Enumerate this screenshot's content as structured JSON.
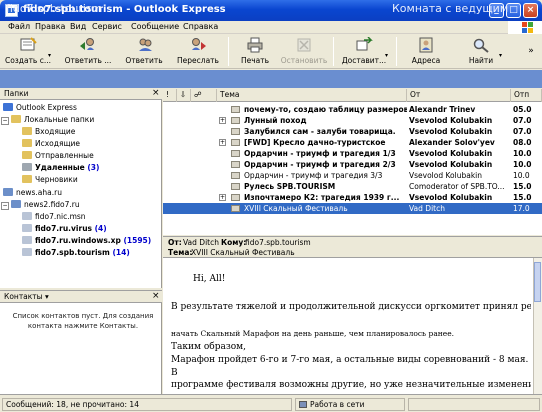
{
  "window": {
    "title": "fido7.spb.tourism - Outlook Express",
    "buttons": {
      "minimize": "_",
      "maximize": "□",
      "close": "×"
    }
  },
  "menu": [
    "Файл",
    "Правка",
    "Вид",
    "Сервис",
    "Сообщение",
    "Справка"
  ],
  "toolbar": {
    "create": "Создать с...",
    "reply": "Ответить ...",
    "reply_all": "Ответить",
    "forward": "Переслать",
    "print": "Печать",
    "delete": "Остановить",
    "send_receive": "Доставит...",
    "addresses": "Адреса",
    "find": "Найти"
  },
  "banner": {
    "title": "fido7.spb.tourism",
    "right": "Комната с ведущим"
  },
  "folders": {
    "header": "Папки",
    "items": [
      {
        "label": "Outlook Express",
        "count": ""
      },
      {
        "label": "Локальные папки",
        "count": ""
      },
      {
        "label": "Входящие",
        "count": ""
      },
      {
        "label": "Исходящие",
        "count": ""
      },
      {
        "label": "Отправленные",
        "count": ""
      },
      {
        "label": "Удаленные",
        "count": "(3)"
      },
      {
        "label": "Черновики",
        "count": ""
      },
      {
        "label": "news.aha.ru",
        "count": ""
      },
      {
        "label": "news2.fido7.ru",
        "count": ""
      },
      {
        "label": "fido7.nic.msn",
        "count": ""
      },
      {
        "label": "fido7.ru.virus",
        "count": "(4)"
      },
      {
        "label": "fido7.ru.windows.xp",
        "count": "(1595)"
      },
      {
        "label": "fido7.spb.tourism",
        "count": "(14)"
      }
    ]
  },
  "contacts": {
    "header": "Контакты ▾",
    "empty_text": "Список контактов пуст. Для создания контакта нажмите Контакты."
  },
  "columns": {
    "subject": "Тема",
    "from": "От",
    "sent": "Отп"
  },
  "messages": [
    {
      "subject": "почему-то, создаю таблицу размеров б...",
      "from": "Alexandr Trinev",
      "date": "05.0"
    },
    {
      "subject": "Лунный поход",
      "from": "Vsevolod Kolubakin",
      "date": "07.0"
    },
    {
      "subject": "Залубился сам - залуби товарища.",
      "from": "Vsevolod Kolubakin",
      "date": "07.0"
    },
    {
      "subject": "[FWD] Кресло дачно-туристское",
      "from": "Alexander Solov'yev",
      "date": "08.0"
    },
    {
      "subject": "Ордарчин - триумф и трагедия 1/3",
      "from": "Vsevolod Kolubakin",
      "date": "10.0"
    },
    {
      "subject": "Ордарчин - триумф и трагедия 2/3",
      "from": "Vsevolod Kolubakin",
      "date": "10.0"
    },
    {
      "subject": "Ордарчин - триумф и трагедия 3/3",
      "from": "Vsevolod Kolubakin",
      "date": "10.0"
    },
    {
      "subject": "Рулесь SPB.TOURISM",
      "from": "Comoderator of SPB.TO...",
      "date": "15.0"
    },
    {
      "subject": "Изпочтамеро К2: трагедия 1939 г...",
      "from": "Vsevolod Kolubakin",
      "date": "15.0"
    },
    {
      "subject": "XVIII Скальный Фестиваль",
      "from": "Vad Ditch",
      "date": "17.0"
    }
  ],
  "preview": {
    "from_label": "От:",
    "from": "Vad Ditch",
    "to_label": "Кому:",
    "to": "fido7.spb.tourism",
    "subject_label": "Тема:",
    "subject": "XVIII Скальный Фестиваль",
    "body": [
      "Hi, All!",
      "В результате тяжелой и продолжительной дискусси оргкомитет принял решение",
      "начать Скальный Марафон на день раньше, чем планировалось ранее.",
      "Таким образом,",
      "Марафон пройдет 6-го и 7-го мая, а остальные виды соревнований - 8 мая.",
      "В",
      "программе фестиваля возможны другие, но уже незначительные изменения,"
    ]
  },
  "status": {
    "messages": "Сообщений: 18, не прочитано: 14",
    "online": "Работа в сети"
  }
}
